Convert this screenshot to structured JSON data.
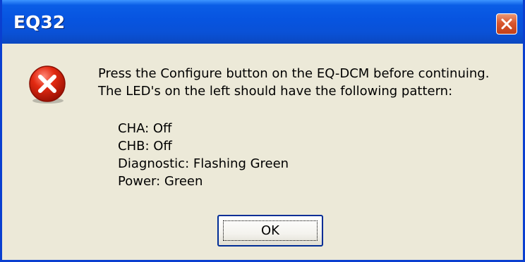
{
  "window": {
    "title": "EQ32",
    "close_icon": "close-icon",
    "title_color": "#0a5de6"
  },
  "dialog": {
    "icon": "error-icon",
    "message_lines": [
      "Press the Configure button on the EQ-DCM before continuing.",
      "The LED's on the left should have the following pattern:"
    ],
    "led_pattern": [
      "CHA:  Off",
      "CHB:  Off",
      "Diagnostic:  Flashing Green",
      "Power:  Green"
    ],
    "ok_label": "OK"
  }
}
